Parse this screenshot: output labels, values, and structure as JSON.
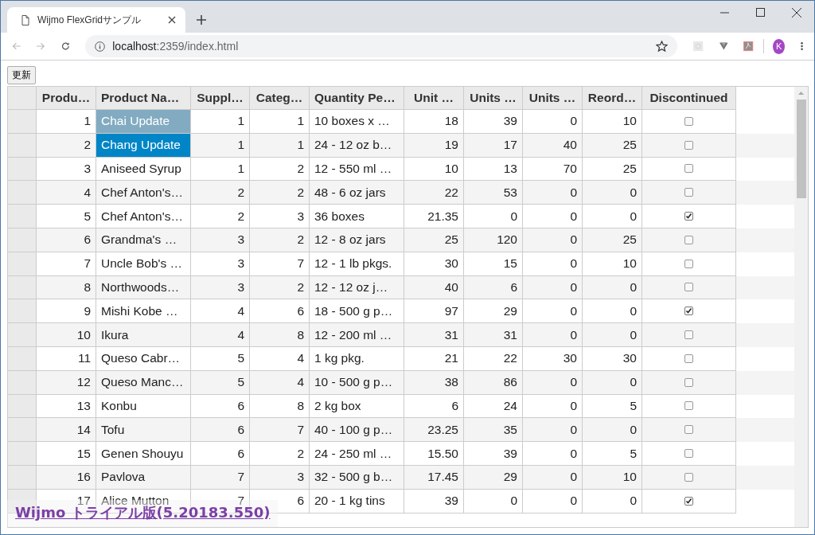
{
  "browser": {
    "tab_title": "Wijmo FlexGridサンプル",
    "url_host": "localhost",
    "url_rest": ":2359/index.html",
    "avatar_letter": "K"
  },
  "refresh_button": "更新",
  "grid": {
    "columns": [
      {
        "label": "Produ…",
        "kind": "number"
      },
      {
        "label": "Product Na…",
        "kind": "text"
      },
      {
        "label": "Suppl…",
        "kind": "number"
      },
      {
        "label": "Categ…",
        "kind": "number"
      },
      {
        "label": "Quantity Pe…",
        "kind": "text"
      },
      {
        "label": "Unit …",
        "kind": "number"
      },
      {
        "label": "Units …",
        "kind": "number"
      },
      {
        "label": "Units …",
        "kind": "number"
      },
      {
        "label": "Reord…",
        "kind": "number"
      },
      {
        "label": "Discontinued",
        "kind": "check"
      }
    ],
    "rows": [
      {
        "cells": [
          "1",
          "Chai Update",
          "1",
          "1",
          "10 boxes x …",
          "18",
          "39",
          "0",
          "10"
        ],
        "discontinued": false,
        "selected": true,
        "current": false
      },
      {
        "cells": [
          "2",
          "Chang Update",
          "1",
          "1",
          "24 - 12 oz b…",
          "19",
          "17",
          "40",
          "25"
        ],
        "discontinued": false,
        "selected": true,
        "current": true
      },
      {
        "cells": [
          "3",
          "Aniseed Syrup",
          "1",
          "2",
          "12 - 550 ml …",
          "10",
          "13",
          "70",
          "25"
        ],
        "discontinued": false,
        "selected": false,
        "current": false
      },
      {
        "cells": [
          "4",
          "Chef Anton's…",
          "2",
          "2",
          "48 - 6 oz jars",
          "22",
          "53",
          "0",
          "0"
        ],
        "discontinued": false,
        "selected": false,
        "current": false
      },
      {
        "cells": [
          "5",
          "Chef Anton's…",
          "2",
          "3",
          "36 boxes",
          "21.35",
          "0",
          "0",
          "0"
        ],
        "discontinued": true,
        "selected": false,
        "current": false
      },
      {
        "cells": [
          "6",
          "Grandma's …",
          "3",
          "2",
          "12 - 8 oz jars",
          "25",
          "120",
          "0",
          "25"
        ],
        "discontinued": false,
        "selected": false,
        "current": false
      },
      {
        "cells": [
          "7",
          "Uncle Bob's …",
          "3",
          "7",
          "12 - 1 lb pkgs.",
          "30",
          "15",
          "0",
          "10"
        ],
        "discontinued": false,
        "selected": false,
        "current": false
      },
      {
        "cells": [
          "8",
          "Northwoods…",
          "3",
          "2",
          "12 - 12 oz j…",
          "40",
          "6",
          "0",
          "0"
        ],
        "discontinued": false,
        "selected": false,
        "current": false
      },
      {
        "cells": [
          "9",
          "Mishi Kobe …",
          "4",
          "6",
          "18 - 500 g p…",
          "97",
          "29",
          "0",
          "0"
        ],
        "discontinued": true,
        "selected": false,
        "current": false
      },
      {
        "cells": [
          "10",
          "Ikura",
          "4",
          "8",
          "12 - 200 ml …",
          "31",
          "31",
          "0",
          "0"
        ],
        "discontinued": false,
        "selected": false,
        "current": false
      },
      {
        "cells": [
          "11",
          "Queso Cabr…",
          "5",
          "4",
          "1 kg pkg.",
          "21",
          "22",
          "30",
          "30"
        ],
        "discontinued": false,
        "selected": false,
        "current": false
      },
      {
        "cells": [
          "12",
          "Queso Manc…",
          "5",
          "4",
          "10 - 500 g p…",
          "38",
          "86",
          "0",
          "0"
        ],
        "discontinued": false,
        "selected": false,
        "current": false
      },
      {
        "cells": [
          "13",
          "Konbu",
          "6",
          "8",
          "2 kg box",
          "6",
          "24",
          "0",
          "5"
        ],
        "discontinued": false,
        "selected": false,
        "current": false
      },
      {
        "cells": [
          "14",
          "Tofu",
          "6",
          "7",
          "40 - 100 g p…",
          "23.25",
          "35",
          "0",
          "0"
        ],
        "discontinued": false,
        "selected": false,
        "current": false
      },
      {
        "cells": [
          "15",
          "Genen Shouyu",
          "6",
          "2",
          "24 - 250 ml …",
          "15.50",
          "39",
          "0",
          "5"
        ],
        "discontinued": false,
        "selected": false,
        "current": false
      },
      {
        "cells": [
          "16",
          "Pavlova",
          "7",
          "3",
          "32 - 500 g b…",
          "17.45",
          "29",
          "0",
          "10"
        ],
        "discontinued": false,
        "selected": false,
        "current": false
      },
      {
        "cells": [
          "17",
          "Alice Mutton",
          "7",
          "6",
          "20 - 1 kg tins",
          "39",
          "0",
          "0",
          "0"
        ],
        "discontinued": true,
        "selected": false,
        "current": false
      }
    ]
  },
  "trial_notice": "Wijmo トライアル版(5.20183.550)"
}
